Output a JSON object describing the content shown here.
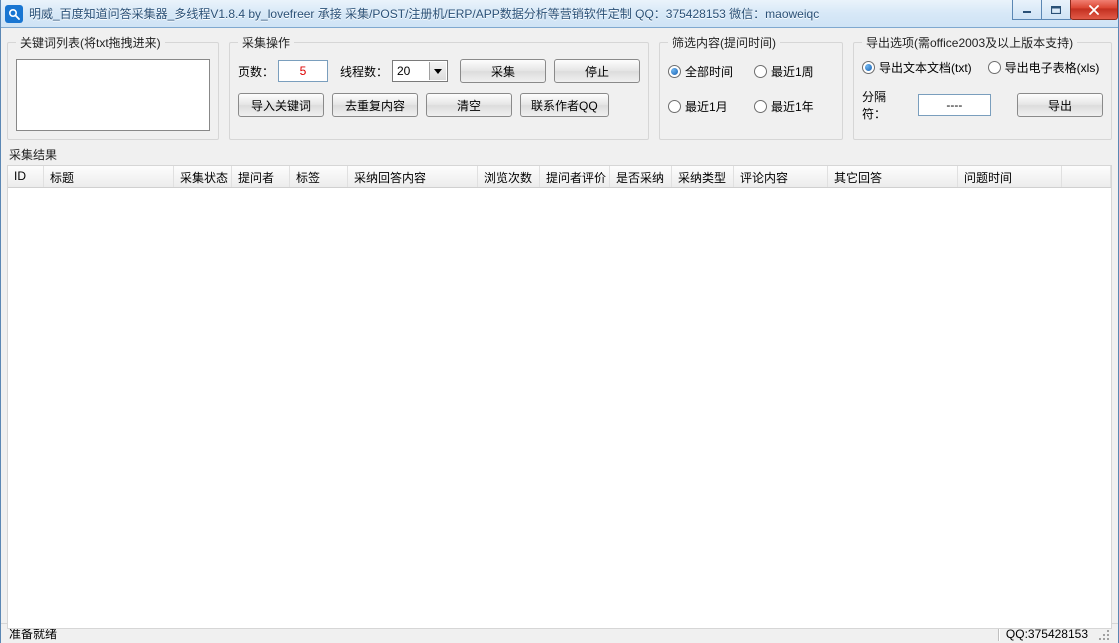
{
  "title": "明威_百度知道问答采集器_多线程V1.8.4 by_lovefreer  承接 采集/POST/注册机/ERP/APP数据分析等营销软件定制 QQ：375428153   微信：maoweiqc",
  "groups": {
    "keywords": {
      "legend": "关键词列表(将txt拖拽进来)"
    },
    "ops": {
      "legend": "采集操作",
      "pages_label": "页数：",
      "pages_value": "5",
      "threads_label": "线程数：",
      "threads_value": "20",
      "collect_btn": "采集",
      "stop_btn": "停止",
      "import_btn": "导入关键词",
      "dedupe_btn": "去重复内容",
      "clear_btn": "清空",
      "contact_btn": "联系作者QQ"
    },
    "filter": {
      "legend": "筛选内容(提问时间)",
      "opt_all": "全部时间",
      "opt_1w": "最近1周",
      "opt_1m": "最近1月",
      "opt_1y": "最近1年",
      "selected": "all"
    },
    "export": {
      "legend": "导出选项(需office2003及以上版本支持)",
      "opt_txt": "导出文本文档(txt)",
      "opt_xls": "导出电子表格(xls)",
      "selected": "txt",
      "sep_label": "分隔符：",
      "sep_value": "----",
      "export_btn": "导出"
    }
  },
  "results": {
    "label": "采集结果",
    "columns": [
      "ID",
      "标题",
      "采集状态",
      "提问者",
      "标签",
      "采纳回答内容",
      "浏览次数",
      "提问者评价",
      "是否采纳",
      "采纳类型",
      "评论内容",
      "其它回答",
      "问题时间"
    ],
    "rows": []
  },
  "status": {
    "left": "准备就绪",
    "right": "QQ:375428153"
  }
}
